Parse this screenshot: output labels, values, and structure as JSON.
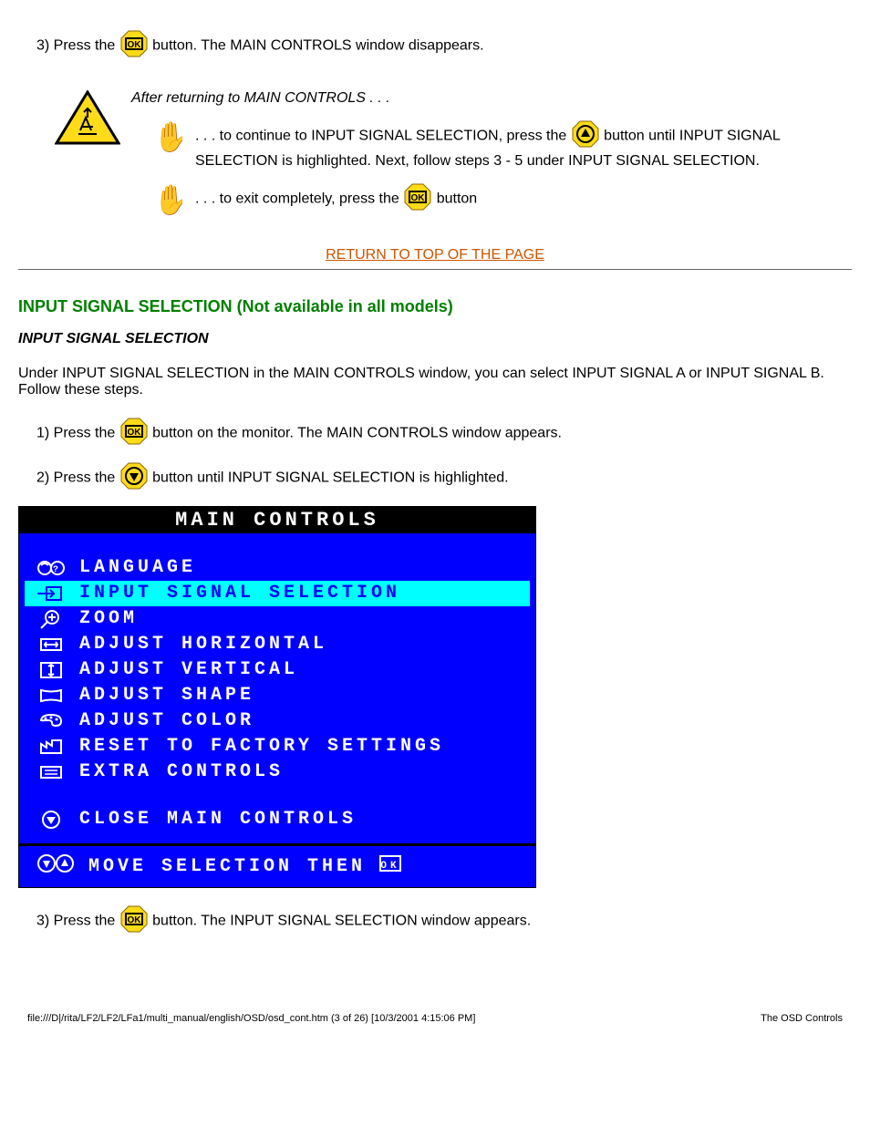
{
  "steps_top": {
    "s3_pre": "3) Press the ",
    "s3_post": " button. The MAIN CONTROLS window disappears.",
    "warn_text": "After returning to MAIN CONTROLS . . .",
    "smart_pre": ". . . to continue to INPUT SIGNAL SELECTION, press the ",
    "smart_mid": " button until INPUT SIGNAL SELECTION is highlighted. Next, follow steps 3 - 5 under INPUT SIGNAL SELECTION.",
    "exit_pre": ". . . to exit completely, press the ",
    "exit_post": " button"
  },
  "return_link": "RETURN TO TOP OF THE PAGE",
  "section_title": "INPUT SIGNAL SELECTION (Not available in all models)",
  "sub_title": "INPUT SIGNAL SELECTION",
  "intro": "Under INPUT SIGNAL SELECTION in the MAIN CONTROLS window, you can select INPUT SIGNAL A or INPUT SIGNAL B. Follow these steps.",
  "steps_mid": {
    "s1_pre": "1) Press the ",
    "s1_post": " button on the monitor. The MAIN CONTROLS window appears.",
    "s2_pre": "2) Press the ",
    "s2_post": " button until INPUT SIGNAL SELECTION is highlighted."
  },
  "osd": {
    "title": "MAIN CONTROLS",
    "items": [
      "LANGUAGE",
      "INPUT SIGNAL SELECTION",
      "ZOOM",
      "ADJUST HORIZONTAL",
      "ADJUST VERTICAL",
      "ADJUST SHAPE",
      "ADJUST COLOR",
      "RESET TO FACTORY SETTINGS",
      "EXTRA CONTROLS"
    ],
    "close": "CLOSE MAIN CONTROLS",
    "footer": "MOVE SELECTION THEN"
  },
  "step3_bottom_pre": "3) Press the ",
  "step3_bottom_post": " button. The INPUT SIGNAL SELECTION window appears.",
  "footer_left": "file:///D|/rita/LF2/LF2/LFa1/multi_manual/english/OSD/osd_cont.htm (3 of 26) [10/3/2001 4:15:06 PM]",
  "footer_right": "The OSD Controls"
}
